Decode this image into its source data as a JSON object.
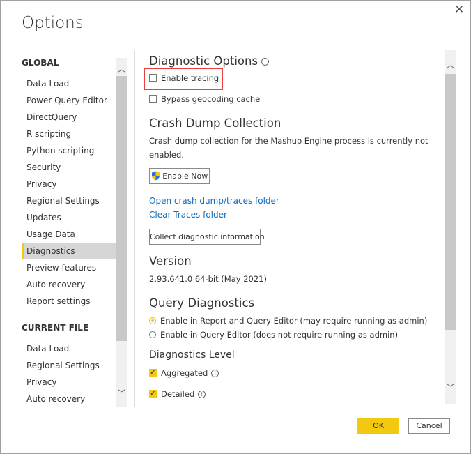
{
  "window": {
    "title": "Options",
    "close_icon": "close-icon"
  },
  "sidebar": {
    "global_header": "GLOBAL",
    "global_items": [
      {
        "label": "Data Load"
      },
      {
        "label": "Power Query Editor"
      },
      {
        "label": "DirectQuery"
      },
      {
        "label": "R scripting"
      },
      {
        "label": "Python scripting"
      },
      {
        "label": "Security"
      },
      {
        "label": "Privacy"
      },
      {
        "label": "Regional Settings"
      },
      {
        "label": "Updates"
      },
      {
        "label": "Usage Data"
      },
      {
        "label": "Diagnostics"
      },
      {
        "label": "Preview features"
      },
      {
        "label": "Auto recovery"
      },
      {
        "label": "Report settings"
      }
    ],
    "selected": "Diagnostics",
    "current_header": "CURRENT FILE",
    "current_items": [
      {
        "label": "Data Load"
      },
      {
        "label": "Regional Settings"
      },
      {
        "label": "Privacy"
      },
      {
        "label": "Auto recovery"
      }
    ]
  },
  "content": {
    "diag_title": "Diagnostic Options",
    "enable_tracing": "Enable tracing",
    "enable_tracing_checked": false,
    "bypass": "Bypass geocoding cache",
    "bypass_checked": false,
    "crash_title": "Crash Dump Collection",
    "crash_text1": "Crash dump collection for the Mashup Engine process is currently not",
    "crash_text2": "enabled.",
    "enable_now": "Enable Now",
    "open_folder": "Open crash dump/traces folder",
    "clear_traces": "Clear Traces folder",
    "collect": "Collect diagnostic information",
    "version_title": "Version",
    "version": "2.93.641.0 64-bit (May 2021)",
    "qd_title": "Query Diagnostics",
    "radio1": "Enable in Report and Query Editor (may require running as admin)",
    "radio2": "Enable in Query Editor (does not require running as admin)",
    "radio_selected": 1,
    "level_title": "Diagnostics Level",
    "aggregated": "Aggregated",
    "detailed": "Detailed",
    "aggregated_checked": true,
    "detailed_checked": true
  },
  "footer": {
    "ok": "OK",
    "cancel": "Cancel"
  },
  "colors": {
    "accent": "#f2c811",
    "highlight": "#e8413b",
    "link": "#0f6cbd"
  }
}
